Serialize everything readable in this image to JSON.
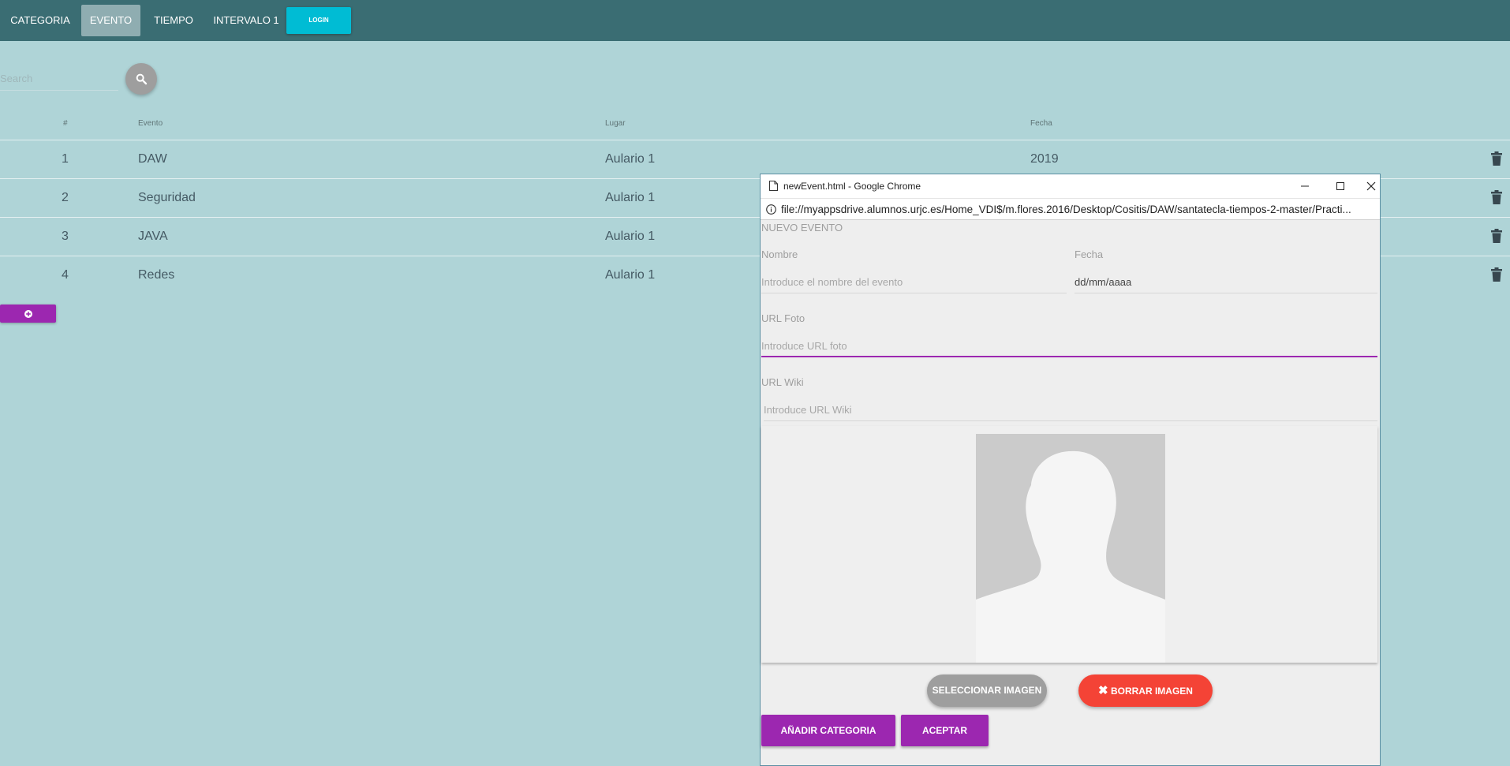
{
  "nav": {
    "items": [
      {
        "label": "CATEGORIA",
        "active": false
      },
      {
        "label": "EVENTO",
        "active": true
      },
      {
        "label": "TIEMPO",
        "active": false
      },
      {
        "label": "INTERVALO 1",
        "active": false
      }
    ],
    "login_label": "LOGIN"
  },
  "search": {
    "placeholder": "Search",
    "icon": "search-icon"
  },
  "table": {
    "headers": [
      "#",
      "Evento",
      "Lugar",
      "Fecha"
    ],
    "rows": [
      {
        "num": "1",
        "evento": "DAW",
        "lugar": "Aulario 1",
        "fecha": "2019"
      },
      {
        "num": "2",
        "evento": "Seguridad",
        "lugar": "Aulario 1",
        "fecha": ""
      },
      {
        "num": "3",
        "evento": "JAVA",
        "lugar": "Aulario 1",
        "fecha": ""
      },
      {
        "num": "4",
        "evento": "Redes",
        "lugar": "Aulario 1",
        "fecha": ""
      }
    ],
    "row_action_icon": "trash-icon"
  },
  "add_button_icon": "plus-circle-icon",
  "popup": {
    "window_title": "newEvent.html - Google Chrome",
    "url": "file://myappsdrive.alumnos.urjc.es/Home_VDI$/m.flores.2016/Desktop/Cositis/DAW/santatecla-tiempos-2-master/Practi...",
    "form": {
      "title": "NUEVO EVENTO",
      "nombre_label": "Nombre",
      "nombre_placeholder": "Introduce el nombre del evento",
      "fecha_label": "Fecha",
      "fecha_value": "dd/mm/aaaa",
      "url_foto_label": "URL Foto",
      "url_foto_placeholder": "Introduce URL foto",
      "url_wiki_label": "URL Wiki",
      "url_wiki_placeholder": "Introduce URL Wiki",
      "select_image_label": "SELECCIONAR IMAGEN",
      "delete_image_label": "BORRAR IMAGEN",
      "add_category_label": "AÑADIR CATEGORIA",
      "accept_label": "ACEPTAR"
    }
  },
  "colors": {
    "background": "#afd4d7",
    "navbar": "#3a6d73",
    "accent_purple": "#9c27b0",
    "login_cyan": "#00bcd4",
    "delete_red": "#f44336"
  }
}
